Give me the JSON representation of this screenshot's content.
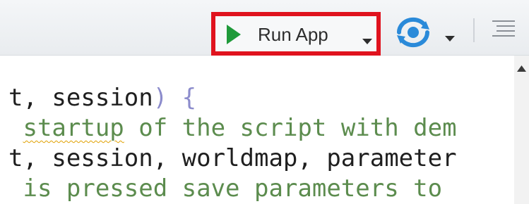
{
  "toolbar": {
    "run_app_label": "Run App",
    "run_app_highlight_color": "#e0131e",
    "play_icon_color": "#1f9a3a",
    "publish_icon_color": "#2a8ad9",
    "icons": [
      "play-icon",
      "chevron-down-icon",
      "publish-icon",
      "outline-icon"
    ]
  },
  "editor": {
    "lines": [
      {
        "code": "t, session",
        "paren_close": ")",
        "brace": " {"
      },
      {
        "prefix": " ",
        "squiggle": "startup",
        "comment": " of the script with dem"
      },
      {
        "code": "t, session, worldmap, parameter"
      },
      {
        "comment": " is pressed save parameters to"
      }
    ]
  }
}
